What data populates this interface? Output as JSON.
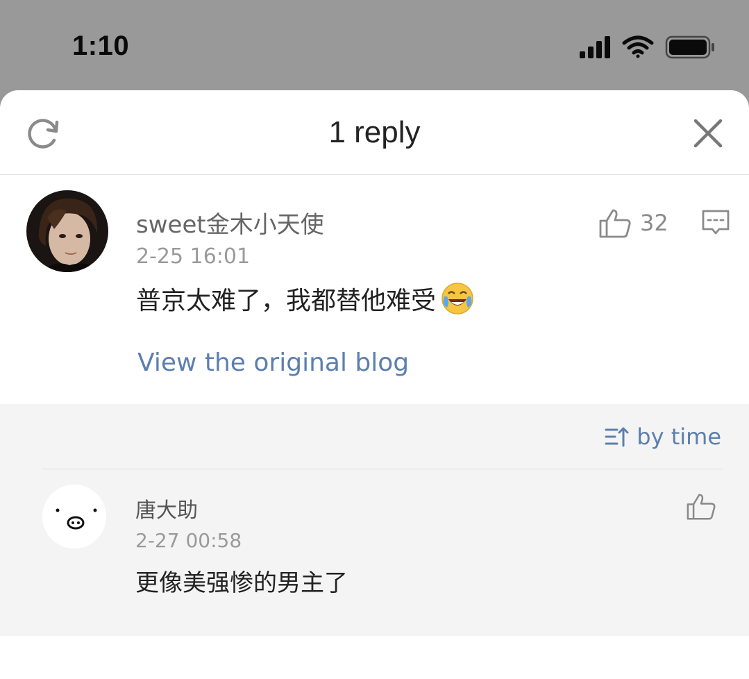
{
  "status_bar": {
    "time": "1:10",
    "icons": [
      "cellular-signal-icon",
      "wifi-icon",
      "battery-icon"
    ]
  },
  "sheet": {
    "title": "1 reply",
    "refresh_icon": "refresh-icon",
    "close_icon": "close-icon"
  },
  "main_comment": {
    "username": "sweet金木小天使",
    "timestamp": "2-25 16:01",
    "text": "普京太难了，我都替他难受",
    "emoji": "laughing-crying-emoji",
    "like_count": "32",
    "view_link": "View the original blog"
  },
  "replies_section": {
    "sort_label": "by time",
    "items": [
      {
        "username": "唐大助",
        "timestamp": "2-27 00:58",
        "text": "更像美强惨的男主了"
      }
    ]
  },
  "colors": {
    "link": "#5b7fae",
    "overlay": "#999999",
    "reply_bg": "#f4f4f4"
  }
}
